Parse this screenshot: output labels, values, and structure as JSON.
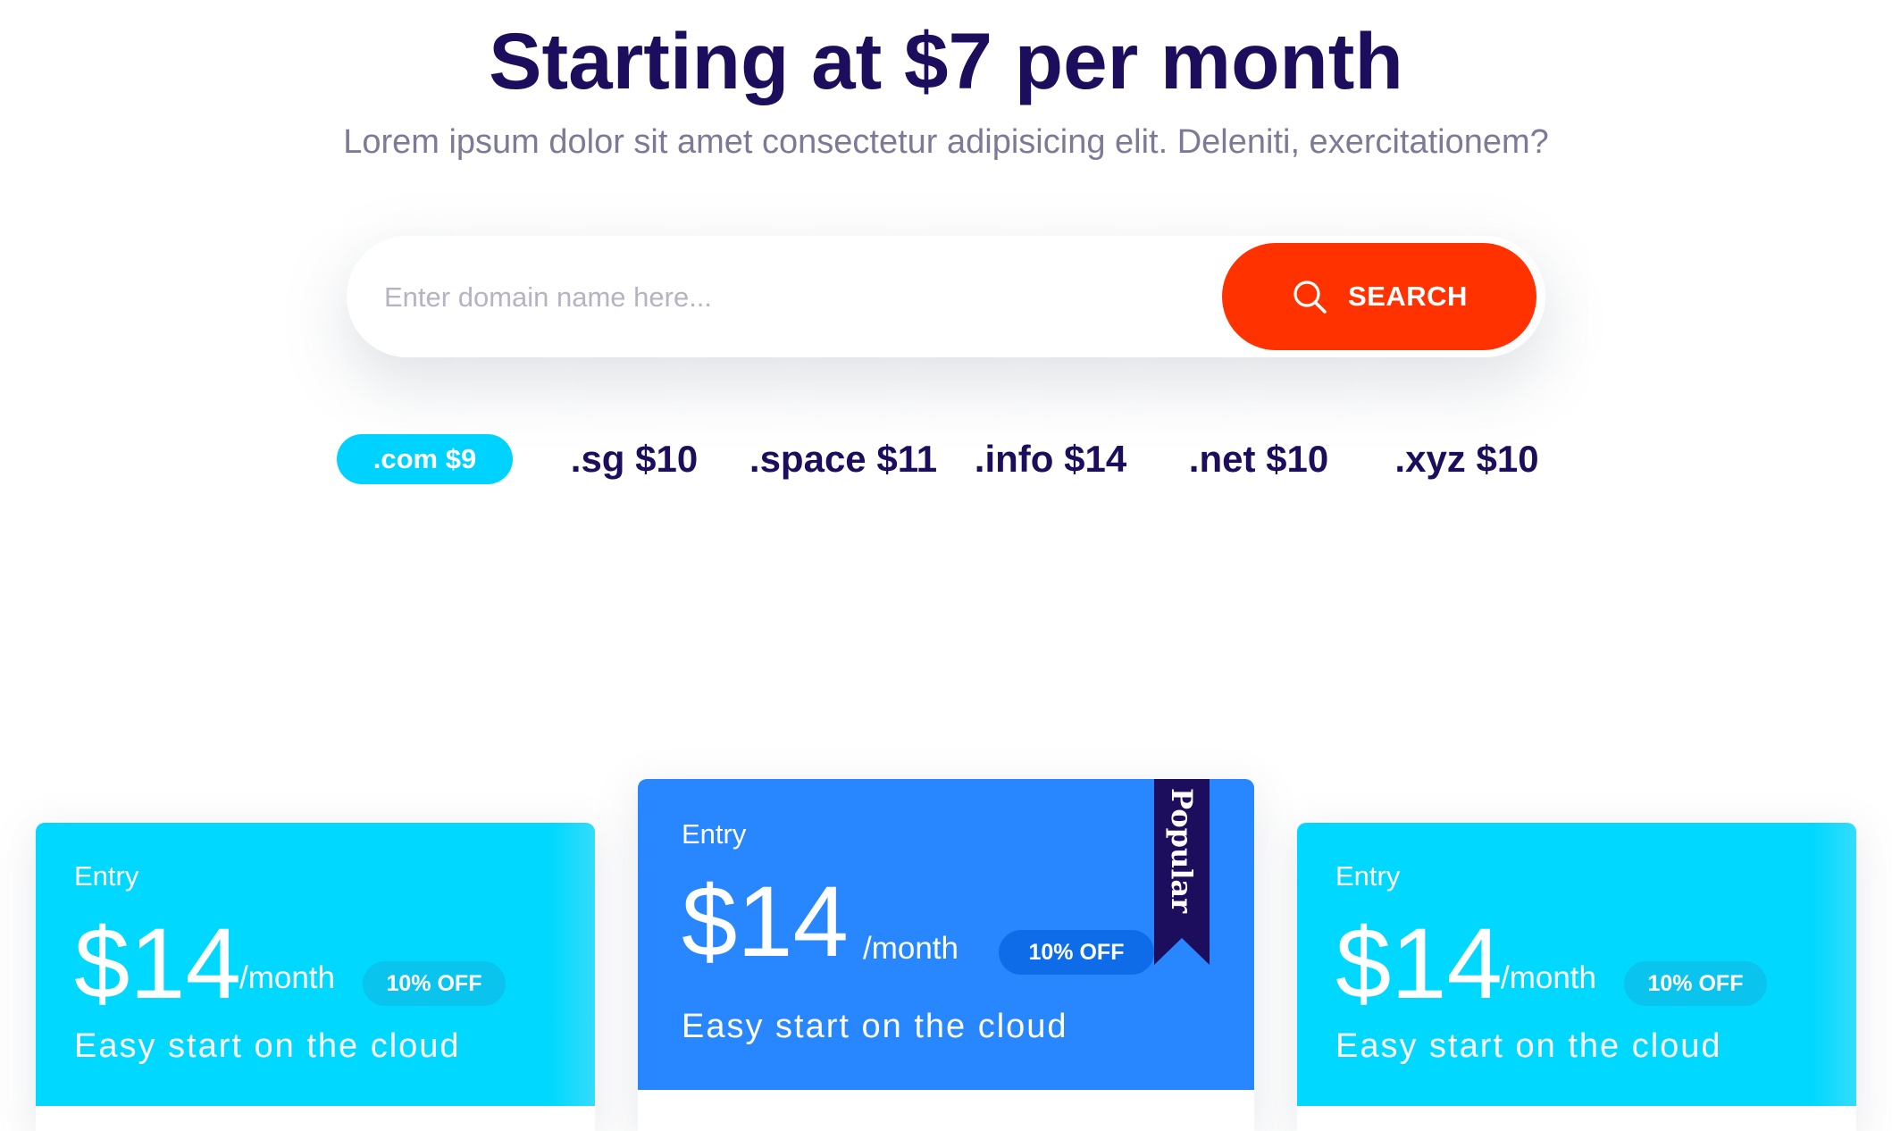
{
  "hero": {
    "title": "Starting at $7 per month",
    "subtitle": "Lorem ipsum dolor sit amet consectetur adipisicing elit. Deleniti, exercitationem?"
  },
  "search": {
    "placeholder": "Enter domain name here...",
    "button_label": "SEARCH",
    "button_icon": "search-icon"
  },
  "tlds": [
    {
      "label": ".com $9",
      "active": true
    },
    {
      "label": ".sg $10",
      "active": false
    },
    {
      "label": ".space $11",
      "active": false
    },
    {
      "label": ".info $14",
      "active": false
    },
    {
      "label": ".net $10",
      "active": false
    },
    {
      "label": ".xyz $10",
      "active": false
    }
  ],
  "plans": [
    {
      "tier": "Entry",
      "price": "$14",
      "period": "/month",
      "discount": "10% OFF",
      "tagline": "Easy start on the cloud",
      "color": "#00d8ff"
    },
    {
      "tier": "Entry",
      "price": "$14",
      "period": "/month",
      "discount": "10% OFF",
      "tagline": "Easy start on the cloud",
      "color": "#2887ff",
      "ribbon": "Popular"
    },
    {
      "tier": "Entry",
      "price": "$14",
      "period": "/month",
      "discount": "10% OFF",
      "tagline": "Easy start on the cloud",
      "color": "#00d8ff"
    }
  ],
  "colors": {
    "heading": "#1c0e5c",
    "accent_orange": "#ff3200",
    "accent_cyan": "#00d2ff",
    "accent_blue": "#2887ff",
    "ribbon": "#1c0e5c"
  }
}
